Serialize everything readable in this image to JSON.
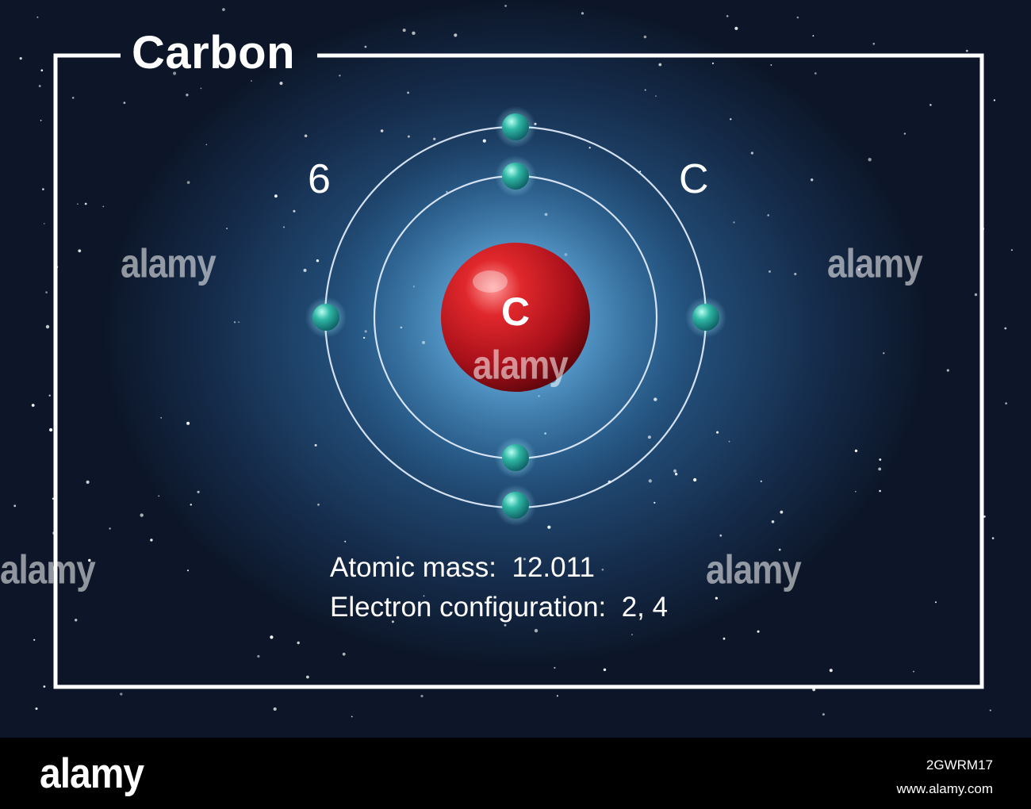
{
  "title": "Carbon",
  "atomic_number": "6",
  "symbol": "C",
  "nucleus_label": "C",
  "atomic_mass_line": "Atomic mass:  12.011",
  "electron_config_line": "Electron configuration:  2, 4",
  "watermark": "alamy",
  "footer": {
    "logo": "alamy",
    "image_id": "2GWRM17",
    "site": "www.alamy.com"
  },
  "colors": {
    "nucleus": "#c0191d",
    "electron": "#2fb7a4",
    "orbit": "#e8f2ff",
    "frame": "#ffffff"
  }
}
